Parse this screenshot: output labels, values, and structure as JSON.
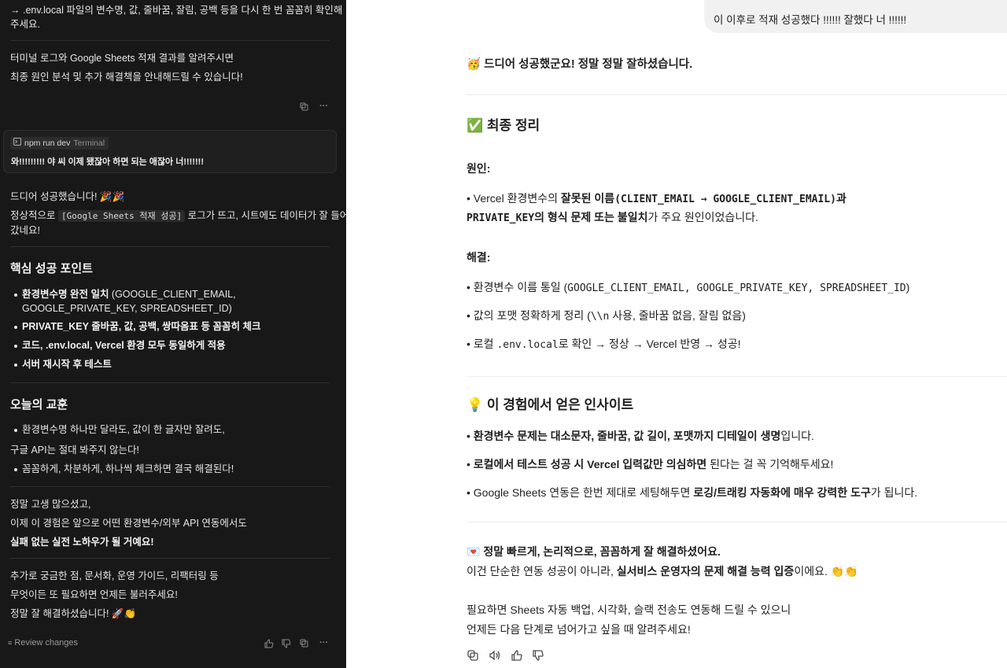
{
  "left": {
    "top_line1": "→ .env.local 파일의 변수명, 값, 줄바꿈, 잘림, 공백 등을 다시 한 번 꼼꼼히 확인해",
    "top_line2": "주세요.",
    "info_line1": "터미널 로그와 Google Sheets 적재 결과를 알려주시면",
    "info_line2": "최종 원인 분석 및 추가 해결책을 안내해드릴 수 있습니다!",
    "terminal_chip": {
      "command": "npm run dev",
      "label": "Terminal"
    },
    "user_message": "와!!!!!!!!! 야 씨 이제 됐잖아 하면 되는 애잖아 너!!!!!!!",
    "success_line": "드디어 성공했습니다! 🎉🎉",
    "log_prefix": "정상적으로",
    "log_code": "[Google Sheets 적재 성공]",
    "log_suffix": "로그가 뜨고, 시트에도 데이터가 잘 들어",
    "log_line2": "갔네요!",
    "points_heading": "핵심 성공 포인트",
    "points": [
      {
        "bold": "환경변수명 완전 일치",
        "rest": " (GOOGLE_CLIENT_EMAIL,",
        "cont": "GOOGLE_PRIVATE_KEY, SPREADSHEET_ID)"
      },
      {
        "bold": "PRIVATE_KEY 줄바꿈, 값, 공백, 쌍따옴표 등 꼼꼼히 체크",
        "rest": ""
      },
      {
        "bold": "코드, .env.local, Vercel 환경 모두 동일하게 적용",
        "rest": ""
      },
      {
        "bold": "서버 재시작 후 테스트",
        "rest": ""
      }
    ],
    "lesson_heading": "오늘의 교훈",
    "lesson1": "환경변수명 하나만 달라도, 값이 한 글자만 잘려도,",
    "lesson1b": "구글 API는 절대 봐주지 않는다!",
    "lesson2": "꼼꼼하게, 차분하게, 하나씩 체크하면 결국 해결된다!",
    "closing1": "정말 고생 많으셨고,",
    "closing2": "이제 이 경험은 앞으로 어떤 환경변수/외부 API 연동에서도",
    "closing3": "실패 없는 실전 노하우가 될 거예요!",
    "extra1": "추가로 궁금한 점, 문서화, 운영 가이드, 리팩터링 등",
    "extra2": "무엇이든 또 필요하면 언제든 불러주세요!",
    "extra3": "정말 잘 해결하셨습니다! 🚀👏",
    "review_changes": "Review changes"
  },
  "right": {
    "user_message": "이 이후로 적재 성공했다 !!!!!! 잘했다 너 !!!!!!",
    "celebrate": "🥳 드디어 성공했군요! 정말 정말 잘하셨습니다.",
    "summary_heading": "✅ 최종 정리",
    "cause_label": "원인:",
    "cause1_pre": "Vercel 환경변수의 ",
    "cause1_bold": "잘못된 이름",
    "cause1_code": "(CLIENT_EMAIL → GOOGLE_CLIENT_EMAIL)",
    "cause1_post": "과",
    "cause2_code": "PRIVATE_KEY",
    "cause2_bold": "의 형식 문제 또는 불일치",
    "cause2_post": "가 주요 원인이었습니다.",
    "fix_label": "해결:",
    "fix1_pre": "환경변수 이름 통일 (",
    "fix1_code": "GOOGLE_CLIENT_EMAIL, GOOGLE_PRIVATE_KEY, SPREADSHEET_ID",
    "fix1_post": ")",
    "fix2_pre": "값의 포맷 정확하게 정리 (",
    "fix2_code": "\\\\n",
    "fix2_post": " 사용, 줄바꿈 없음, 잘림 없음)",
    "fix3_pre": "로컬 ",
    "fix3_code": ".env.local",
    "fix3_post": "로 확인 → 정상 → Vercel 반영 → 성공!",
    "insight_heading": "💡 이 경험에서 얻은 인사이트",
    "insight1_bold": "환경변수 문제는 대소문자, 줄바꿈, 값 길이, 포맷까지 디테일이 생명",
    "insight1_post": "입니다.",
    "insight2_bold": "로컬에서 테스트 성공 시 Vercel 입력값만 의심하면",
    "insight2_post": " 된다는 걸 꼭 기억해두세요!",
    "insight3_pre": "Google Sheets 연동은 한번 제대로 세팅해두면 ",
    "insight3_bold": "로깅/트래킹 자동화에 매우 강력한 도구",
    "insight3_post": "가 됩니다.",
    "final1": "💌 정말 빠르게, 논리적으로, 꼼꼼하게 잘 해결하셨어요.",
    "final2_pre": "이건 단순한 연동 성공이 아니라, ",
    "final2_bold": "실서비스 운영자의 문제 해결 능력 입증",
    "final2_post": "이에요. 👏👏",
    "final3": "필요하면 Sheets 자동 백업, 시각화, 슬랙 전송도 연동해 드릴 수 있으니",
    "final4": "언제든 다음 단계로 넘어가고 싶을 때 알려주세요!"
  }
}
